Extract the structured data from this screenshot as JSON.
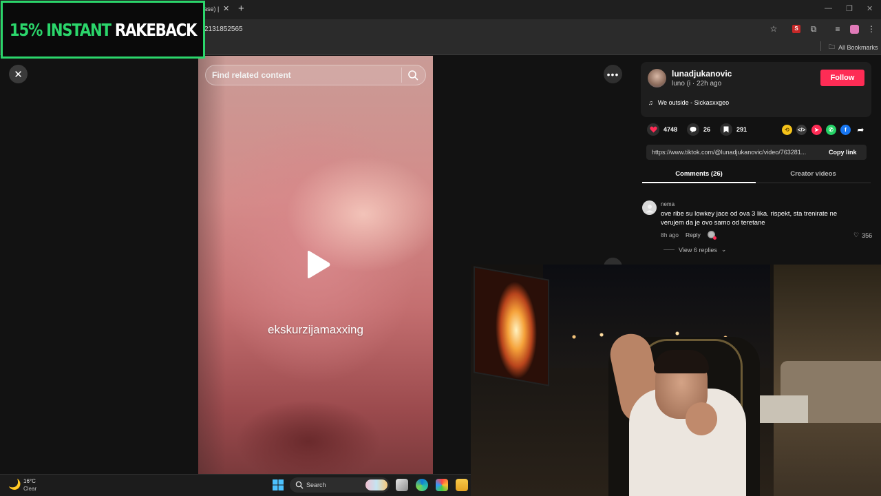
{
  "browser": {
    "tab_fragment": "ase) |",
    "url_fragment": "2131852565",
    "bookmarks_label": "All Bookmarks"
  },
  "overlay": {
    "rakeback_green": "15% INSTANT",
    "rakeback_white": "RAKEBACK",
    "accent": "#2bd66b"
  },
  "viewer": {
    "search_placeholder": "Find related content",
    "video_caption": "ekskurzijamaxxing"
  },
  "creator": {
    "username": "lunadjukanovic",
    "nickname": "luno (Ꭵ",
    "separator": "·",
    "posted": "22h ago",
    "follow_label": "Follow",
    "follow_color": "#fe2c55",
    "music": "We outside - Sickasxxgeo"
  },
  "stats": {
    "likes": "4748",
    "comments": "26",
    "saves": "291"
  },
  "share": {
    "link": "https://www.tiktok.com/@lunadjukanovic/video/763281...",
    "copy_label": "Copy link",
    "icons": [
      "repost-icon",
      "embed-icon",
      "send-icon",
      "whatsapp-icon",
      "facebook-icon",
      "share-arrow-icon"
    ]
  },
  "tabs": {
    "comments": "Comments (26)",
    "creator_videos": "Creator videos"
  },
  "comment": {
    "user": "nema",
    "text": "ove ribe su lowkey jace od ova 3 lika. rispekt, sta trenirate ne verujem da je ovo samo od teretane",
    "time": "8h ago",
    "reply_label": "Reply",
    "likes": "356",
    "view_replies": "View 6 replies"
  },
  "taskbar": {
    "temp": "16°C",
    "weather": "Clear",
    "search_label": "Search"
  }
}
